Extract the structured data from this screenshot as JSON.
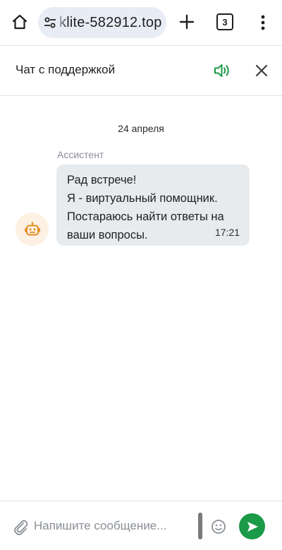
{
  "browser": {
    "url_text": "klite-582912.top",
    "tab_count": "3",
    "icons": {
      "home": "home-icon",
      "site_settings": "tune-icon",
      "new_tab": "plus-icon",
      "menu": "more-vert-icon"
    }
  },
  "chat": {
    "title": "Чат с поддержкой",
    "icons": {
      "sound": "volume-icon",
      "close": "close-icon"
    },
    "accent_color": "#1b9a48"
  },
  "messages": {
    "date_label": "24 апреля",
    "items": [
      {
        "sender": "Ассистент",
        "avatar_icon": "robot-icon",
        "lines": [
          "Рад встрече!",
          "Я - виртуальный помощник.",
          "Постараюсь найти ответы на",
          "ваши вопросы."
        ],
        "time": "17:21"
      }
    ]
  },
  "composer": {
    "placeholder": "Напишите сообщение...",
    "value": "",
    "icons": {
      "attach": "paperclip-icon",
      "emoji": "emoji-icon",
      "send": "send-icon"
    }
  }
}
